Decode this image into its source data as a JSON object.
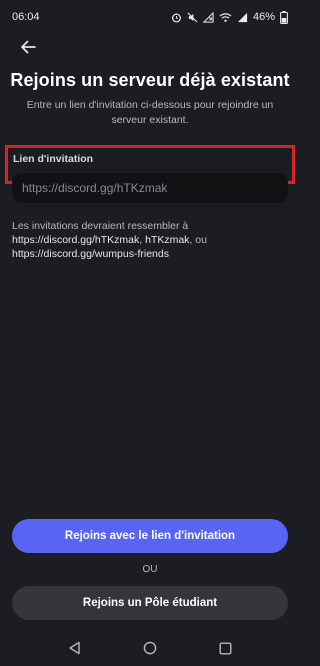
{
  "status_bar": {
    "time": "06:04",
    "battery": "46%"
  },
  "header": {
    "back_icon": "arrow-left-icon",
    "title": "Rejoins un serveur déjà existant",
    "subtitle": "Entre un lien d'invitation ci-dessous pour rejoindre un serveur existant."
  },
  "invite": {
    "label": "Lien d'invitation",
    "placeholder": "https://discord.gg/hTKzmak",
    "value": "",
    "hint_prefix": "Les invitations devraient ressembler à ",
    "hint_example_1": "https://discord.gg/hTKzmak",
    "hint_sep_1": ", ",
    "hint_example_2": "hTKzmak",
    "hint_sep_2": ", ou ",
    "hint_example_3": "https://discord.gg/wumpus-friends"
  },
  "actions": {
    "join_label": "Rejoins avec le lien d'invitation",
    "or_label": "OU",
    "student_hub_label": "Rejoins un Pôle étudiant"
  },
  "colors": {
    "background": "#1c1d22",
    "primary": "#5865f2",
    "secondary": "#34363c",
    "highlight": "#d8232f"
  }
}
